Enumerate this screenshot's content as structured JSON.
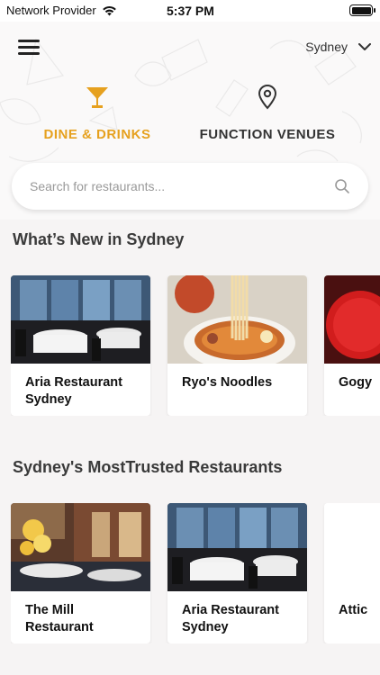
{
  "status_bar": {
    "carrier": "Network Provider",
    "time": "5:37 PM"
  },
  "header": {
    "city": "Sydney"
  },
  "tabs": [
    {
      "label": "DINE & DRINKS",
      "icon": "cocktail-glass-icon",
      "active": true,
      "color": "#e6a11f"
    },
    {
      "label": "FUNCTION VENUES",
      "icon": "location-pin-icon",
      "active": false,
      "color": "#333333"
    }
  ],
  "search": {
    "placeholder": "Search for restaurants..."
  },
  "sections": [
    {
      "title": "What’s New in Sydney",
      "cards": [
        {
          "name": "Aria Restaurant Sydney",
          "image": "restaurant-dining-room-harbour-view"
        },
        {
          "name": "Ryo's Noodles",
          "image": "ramen-noodle-bowl"
        },
        {
          "name": "Gogy",
          "image": "red-lacquer-bowl"
        }
      ]
    },
    {
      "title": "Sydney's MostTrusted Restaurants",
      "cards": [
        {
          "name": "The Mill Restaurant",
          "image": "restaurant-interior-flowers"
        },
        {
          "name": "Aria Restaurant Sydney",
          "image": "restaurant-dining-room-harbour-view"
        },
        {
          "name": "Attic",
          "image": "blank"
        }
      ]
    }
  ],
  "colors": {
    "accent": "#e6a11f",
    "background": "#f6f4f4"
  }
}
